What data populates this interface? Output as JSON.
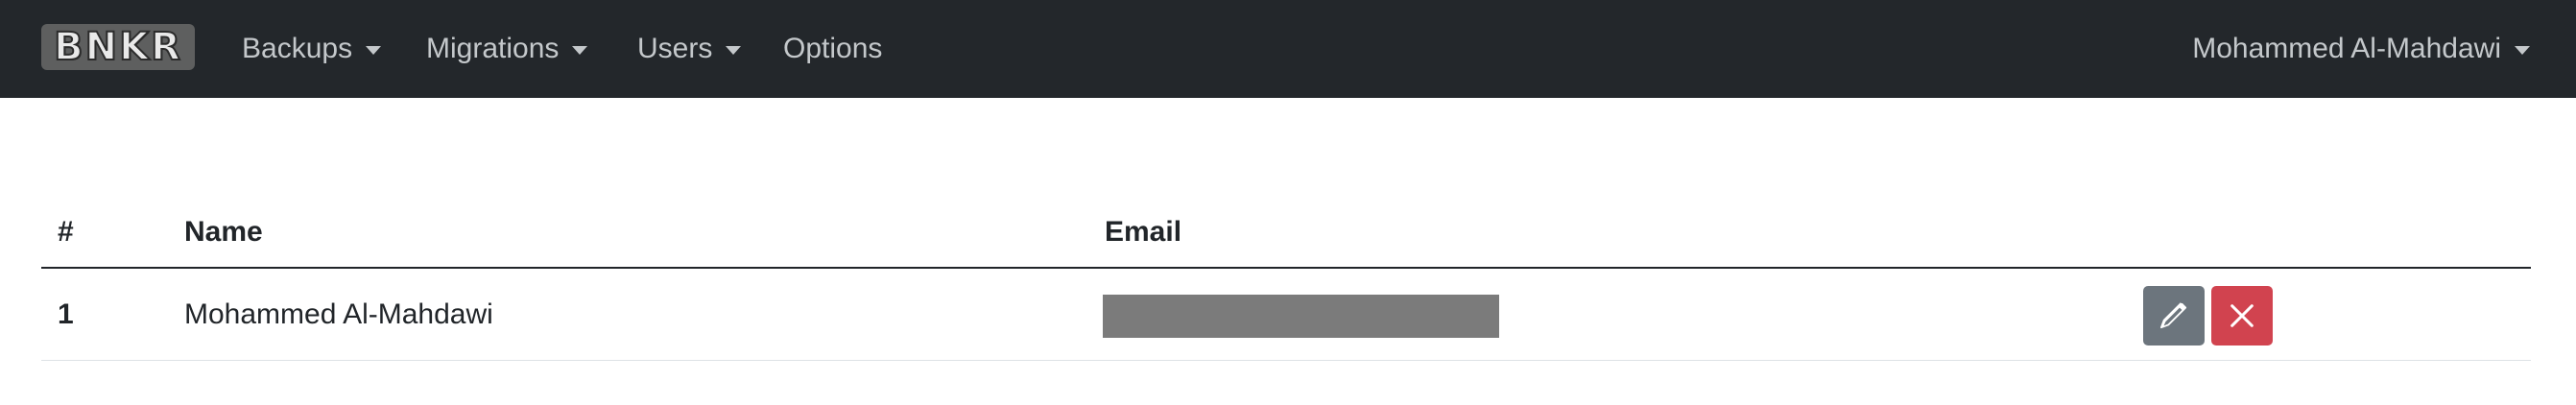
{
  "navbar": {
    "brand_text": "BNKR",
    "items": [
      {
        "label": "Backups",
        "has_dropdown": true
      },
      {
        "label": "Migrations",
        "has_dropdown": true
      },
      {
        "label": "Users",
        "has_dropdown": true
      },
      {
        "label": "Options",
        "has_dropdown": false
      }
    ],
    "user_menu": {
      "label": "Mohammed Al-Mahdawi",
      "has_dropdown": true
    },
    "background_color": "#23272b"
  },
  "table": {
    "columns": [
      "#",
      "Name",
      "Email",
      ""
    ],
    "rows": [
      {
        "num": "1",
        "name": "Mohammed Al-Mahdawi",
        "email_redacted": true,
        "actions": [
          "pencil-icon",
          "close-icon"
        ]
      }
    ]
  },
  "colors": {
    "edit_button": "#6c757d",
    "delete_button": "#d1434f",
    "redaction": "#7b7b7b"
  }
}
